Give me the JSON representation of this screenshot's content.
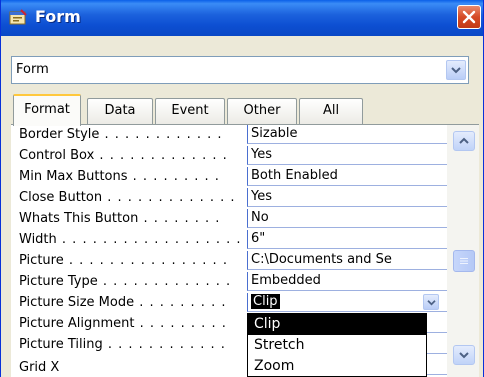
{
  "window": {
    "title": "Form",
    "icon": "form-icon",
    "close_icon": "close-icon"
  },
  "object_selector": {
    "value": "Form"
  },
  "tabs": [
    {
      "label": "Format",
      "active": true
    },
    {
      "label": "Data",
      "active": false
    },
    {
      "label": "Event",
      "active": false
    },
    {
      "label": "Other",
      "active": false
    },
    {
      "label": "All",
      "active": false
    }
  ],
  "properties": [
    {
      "label": "Border Style",
      "dots": " . . . . . . . . . . . . ",
      "value": "Sizable"
    },
    {
      "label": "Control Box",
      "dots": " . . . . . . . . . . . . . ",
      "value": "Yes"
    },
    {
      "label": "Min Max Buttons",
      "dots": " . . . . . . . . . ",
      "value": "Both Enabled"
    },
    {
      "label": "Close Button",
      "dots": " . . . . . . . . . . . . . ",
      "value": "Yes"
    },
    {
      "label": "Whats This Button",
      "dots": " . . . . . . . . ",
      "value": "No"
    },
    {
      "label": "Width",
      "dots": " . . . . . . . . . . . . . . . . . . ",
      "value": "6\""
    },
    {
      "label": "Picture",
      "dots": " . . . . . . . . . . . . . . . . ",
      "value": "C:\\Documents and Se"
    },
    {
      "label": "Picture Type",
      "dots": " . . . . . . . . . . . . . ",
      "value": "Embedded"
    },
    {
      "label": "Picture Size Mode",
      "dots": " . . . . . . . . . ",
      "value": "Clip",
      "selected": true
    },
    {
      "label": "Picture Alignment",
      "dots": " . . . . . . . . . ",
      "value": ""
    },
    {
      "label": "Picture Tiling",
      "dots": " . . . . . . . . . . . . ",
      "value": ""
    },
    {
      "label": "Grid X",
      "dots": "",
      "value": ""
    }
  ],
  "dropdown_options": [
    {
      "label": "Clip",
      "highlighted": true
    },
    {
      "label": "Stretch",
      "highlighted": false
    },
    {
      "label": "Zoom",
      "highlighted": false
    }
  ],
  "scrollbar": {
    "up_icon": "chevron-up-icon",
    "down_icon": "chevron-down-icon",
    "thumb_icon": "grip-icon"
  },
  "colors": {
    "titlebar": "#0a5fe8",
    "close": "#d64a25",
    "selection": "#000000",
    "tab_accent": "#ffc83c"
  }
}
